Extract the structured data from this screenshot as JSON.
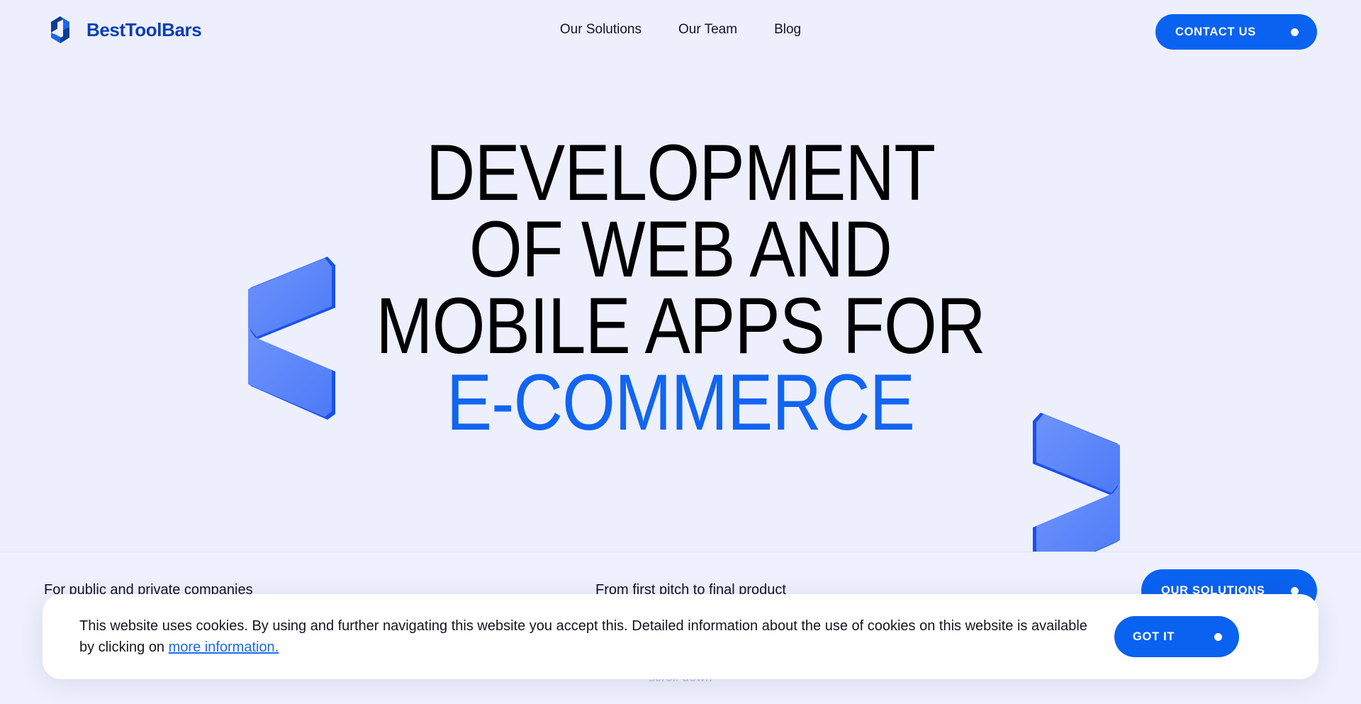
{
  "colors": {
    "page_background": "#EDEFFC",
    "brand_blue": "#0B3FB4",
    "accent_blue": "#0A62F0",
    "headline_accent": "#1165F0",
    "chevron_light": "#5C86FA",
    "chevron_edge": "#1A50EE",
    "text_dark": "#010103",
    "link_blue": "#1A6BF0",
    "scroll_hint": "#B9BCCF"
  },
  "header": {
    "logo_icon": "besttoolbars-chevron-diamond-logo",
    "brand_name": "BestToolBars",
    "nav": [
      {
        "label": "Our Solutions"
      },
      {
        "label": "Our Team"
      },
      {
        "label": "Blog"
      }
    ],
    "contact_button": {
      "label": "CONTACT US",
      "dot_icon": "dot-icon"
    }
  },
  "hero": {
    "headline_lines": [
      {
        "text": "DEVELOPMENT",
        "accent": false
      },
      {
        "text": "OF WEB AND",
        "accent": false
      },
      {
        "text": "MOBILE APPS FOR",
        "accent": false
      },
      {
        "text": "E-COMMERCE",
        "accent": true
      }
    ],
    "decorations": {
      "left_chevron_icon": "chevron-left-3d-decoration",
      "right_chevron_icon": "chevron-right-3d-decoration"
    }
  },
  "feature_strip": {
    "items": [
      {
        "label": "For public and private companies"
      },
      {
        "label": "From first pitch to final product"
      }
    ],
    "solutions_button": {
      "label": "OUR SOLUTIONS",
      "dot_icon": "dot-icon"
    },
    "scroll_hint": "scroll down"
  },
  "cookie_banner": {
    "text_before_link": "This website uses cookies. By using and further navigating this website you accept this. Detailed information about the use of cookies on this website is available by clicking on ",
    "link_label": "more information.",
    "accept_button": {
      "label": "GOT IT",
      "dot_icon": "dot-icon"
    }
  }
}
